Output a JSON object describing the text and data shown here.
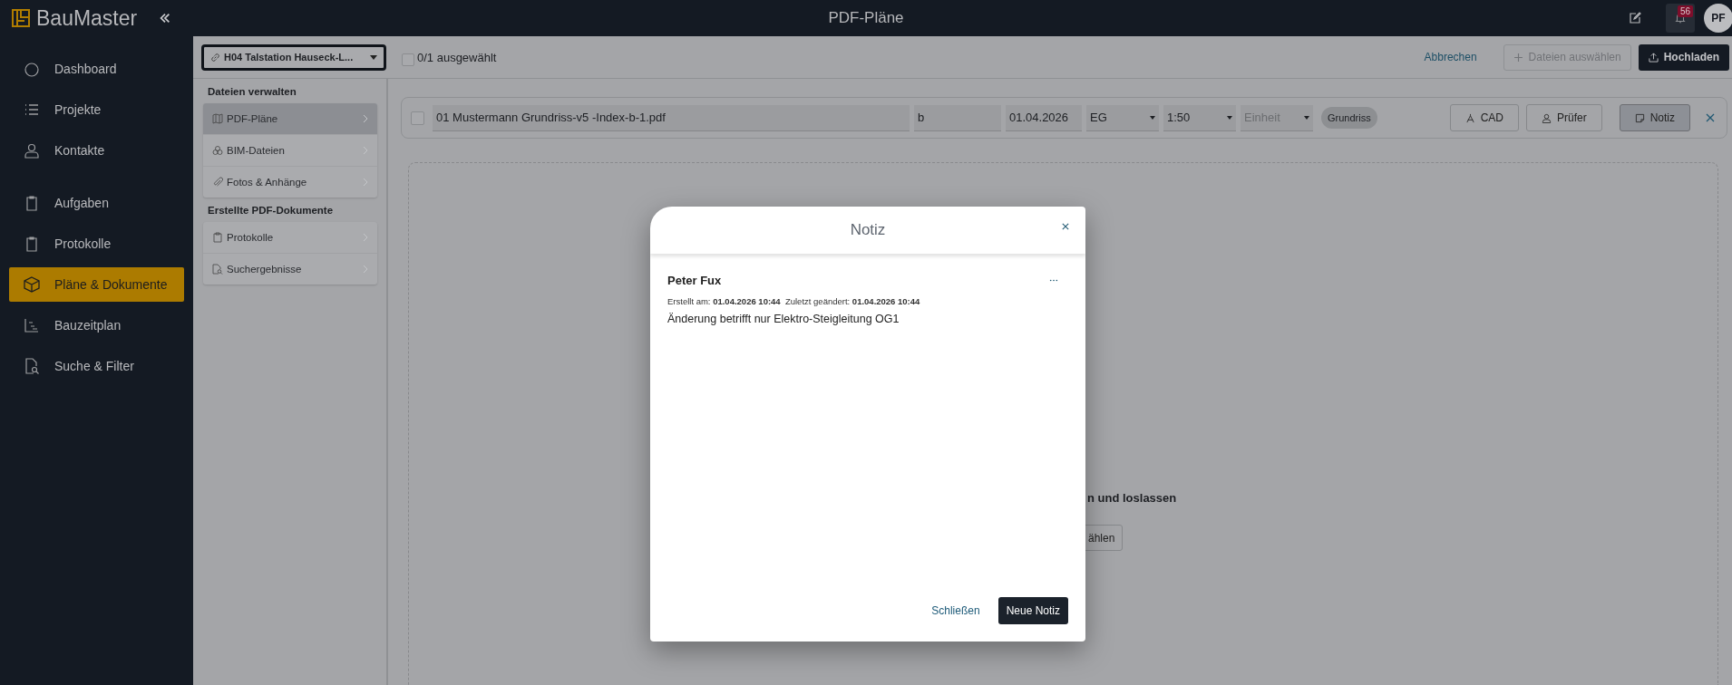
{
  "app": {
    "logo": "BauMaster",
    "page_title": "PDF-Pläne",
    "notification_count": "56",
    "avatar": "PF"
  },
  "nav_groups": [
    [
      {
        "label": "Dashboard",
        "selected": false
      },
      {
        "label": "Projekte",
        "selected": false
      },
      {
        "label": "Kontakte",
        "selected": false
      }
    ],
    [
      {
        "label": "Aufgaben",
        "selected": false
      },
      {
        "label": "Protokolle",
        "selected": false
      },
      {
        "label": "Pläne & Dokumente",
        "selected": true
      },
      {
        "label": "Bauzeitplan",
        "selected": false
      },
      {
        "label": "Suche & Filter",
        "selected": false
      }
    ]
  ],
  "project_select": {
    "value": "H04 Talstation Hauseck-L..."
  },
  "selection": {
    "label": "0/1 ausgewählt",
    "checked": false
  },
  "actions": [
    {
      "label": "Abbrechen",
      "kind": "link"
    },
    {
      "label": "Dateien auswählen",
      "kind": "add",
      "disabled": true
    },
    {
      "label": "Hochladen",
      "kind": "upload"
    }
  ],
  "file_nav": [
    {
      "heading": "Dateien verwalten",
      "items": [
        {
          "label": "PDF-Pläne",
          "selected": true
        },
        {
          "label": "BIM-Dateien",
          "selected": false
        },
        {
          "label": "Fotos & Anhänge",
          "selected": false
        }
      ]
    },
    {
      "heading": "Erstellte PDF-Dokumente",
      "items": [
        {
          "label": "Protokolle",
          "selected": false
        },
        {
          "label": "Suchergebnisse",
          "selected": false
        }
      ]
    }
  ],
  "file_row": {
    "checked": false,
    "name": "01 Mustermann Grundriss-v5 -Index-b-1.pdf",
    "index": "b",
    "date": "01.04.2026",
    "floor": "EG",
    "scale": "1:50",
    "unit_placeholder": "Einheit",
    "tag": "Grundriss",
    "buttons": [
      {
        "label": "CAD",
        "selected": false
      },
      {
        "label": "Prüfer",
        "selected": false
      },
      {
        "label": "Notiz",
        "selected": true
      }
    ]
  },
  "dropzone": {
    "title": "n und loslassen",
    "button": "ählen"
  },
  "modal": {
    "title": "Notiz",
    "author": "Peter Fux",
    "meta": "Erstellt am: **01.04.2026 10:44**  Zuletzt geändert: **01.04.2026 10:44**",
    "text": "Änderung betrifft nur Elektro-Steigleitung OG1",
    "buttons": [
      {
        "label": "Schließen",
        "kind": "link"
      },
      {
        "label": "Neue Notiz",
        "kind": "primary"
      }
    ]
  }
}
